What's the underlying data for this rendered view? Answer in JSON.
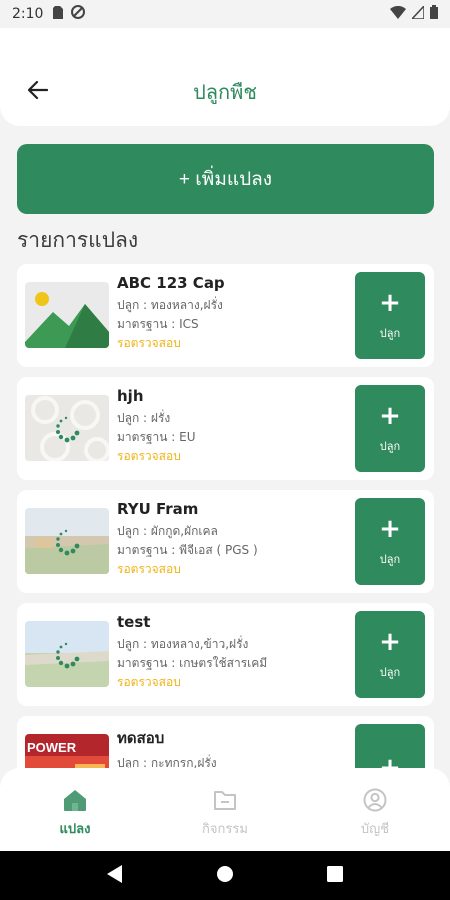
{
  "status_bar": {
    "time": "2:10"
  },
  "header": {
    "title": "ปลูกพืช"
  },
  "add_button": {
    "label": "+ เพิ่มแปลง"
  },
  "section_title": "รายการแปลง",
  "plots": [
    {
      "name": "ABC 123 Cap",
      "crop": "ปลูก : ทองหลาง,ฝรั่ง",
      "standard": "มาตรฐาน : ICS",
      "status": "รอตรวจสอบ",
      "plant_label": "ปลูก"
    },
    {
      "name": "hjh",
      "crop": "ปลูก : ฝรั่ง",
      "standard": "มาตรฐาน : EU",
      "status": "รอตรวจสอบ",
      "plant_label": "ปลูก"
    },
    {
      "name": "RYU Fram",
      "crop": "ปลูก : ผักกูด,ผักเคล",
      "standard": "มาตรฐาน : พีจีเอส ( PGS )",
      "status": "รอตรวจสอบ",
      "plant_label": "ปลูก"
    },
    {
      "name": "test",
      "crop": "ปลูก : ทองหลาง,ข้าว,ฝรั่ง",
      "standard": "มาตรฐาน : เกษตรใช้สารเคมี",
      "status": "รอตรวจสอบ",
      "plant_label": "ปลูก"
    },
    {
      "name": "ทดสอบ",
      "crop": "ปลูก : กะทกรก,ฝรั่ง",
      "standard": "",
      "status": "",
      "plant_label": ""
    }
  ],
  "thumb_texts": {
    "poster": "POWER"
  },
  "bottom_nav": [
    {
      "label": "แปลง",
      "icon": "home-icon",
      "active": true
    },
    {
      "label": "กิจกรรม",
      "icon": "folder-icon",
      "active": false
    },
    {
      "label": "บัญชี",
      "icon": "account-icon",
      "active": false
    }
  ],
  "colors": {
    "primary": "#2f8a5d",
    "status": "#f0b419",
    "background": "#f2f3f2"
  }
}
